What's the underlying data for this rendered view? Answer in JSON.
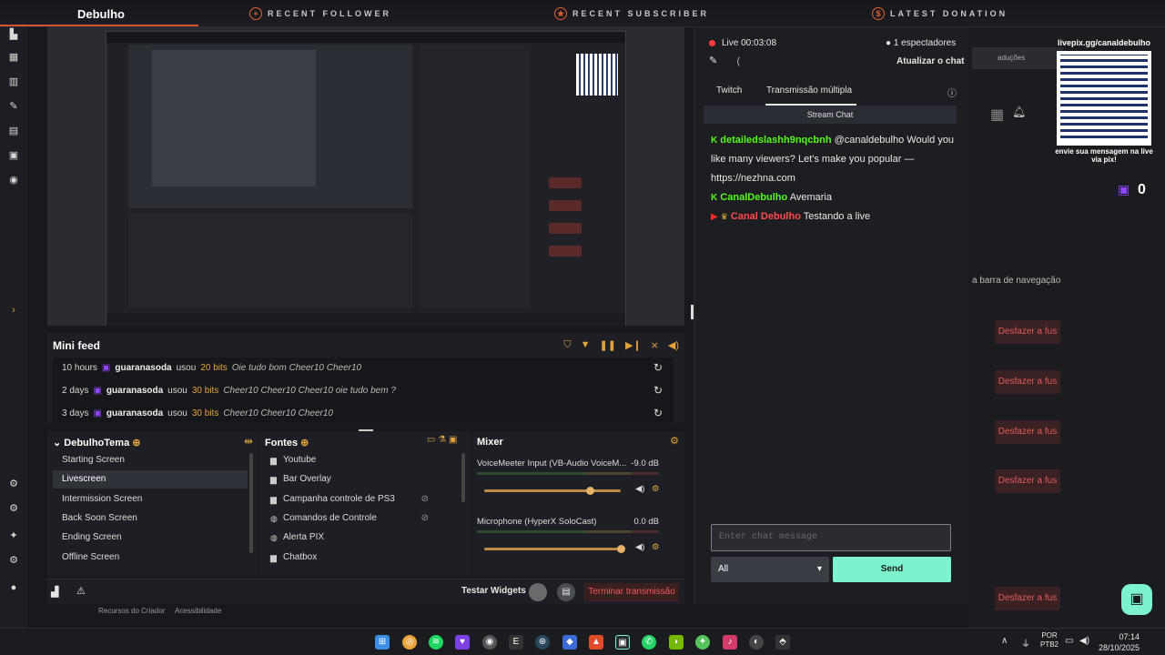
{
  "overlay": {
    "title": "Debulho",
    "segments": [
      "RECENT FOLLOWER",
      "RECENT SUBSCRIBER",
      "LATEST DONATION"
    ],
    "accent": "#e2632e"
  },
  "minifeed": {
    "title": "Mini feed",
    "rows": [
      {
        "time": "10 hours",
        "user": "guaranasoda",
        "action": "usou",
        "bits": "20 bits",
        "msg": "Oie tudo bom Cheer10 Cheer10"
      },
      {
        "time": "2 days",
        "user": "guaranasoda",
        "action": "usou",
        "bits": "30 bits",
        "msg": "Cheer10 Cheer10 Cheer10 oie tudo bem ?"
      },
      {
        "time": "3 days",
        "user": "guaranasoda",
        "action": "usou",
        "bits": "30 bits",
        "msg": "Cheer10 Cheer10 Cheer10"
      }
    ]
  },
  "scenes": {
    "title": "DebulhoTema",
    "items": [
      "Starting Screen",
      "Livescreen",
      "Intermission Screen",
      "Back Soon Screen",
      "Ending Screen",
      "Offline Screen"
    ],
    "active": 1
  },
  "sources": {
    "title": "Fontes",
    "items": [
      {
        "label": "Youtube",
        "icon": "folder-icon",
        "glyph": "▆"
      },
      {
        "label": "Bar Overlay",
        "icon": "folder-icon",
        "glyph": "▆"
      },
      {
        "label": "Campanha controle de PS3",
        "icon": "gamepad-icon",
        "glyph": "▆"
      },
      {
        "label": "Comandos de Controle",
        "icon": "globe-icon",
        "glyph": "◍"
      },
      {
        "label": "Alerta PIX",
        "icon": "globe-icon",
        "glyph": "◍"
      },
      {
        "label": "Chatbox",
        "icon": "folder-icon",
        "glyph": "▆"
      }
    ]
  },
  "mixer": {
    "title": "Mixer",
    "channels": [
      {
        "name": "VoiceMeeter Input (VB-Audio VoiceM...",
        "db": "-9.0 dB",
        "level": 0.78
      },
      {
        "name": "Microphone (HyperX SoloCast)",
        "db": "0.0 dB",
        "level": 1.0
      }
    ]
  },
  "bottombar": {
    "test_widgets": "Testar Widgets",
    "end_stream": "Terminar transmissão"
  },
  "chat": {
    "live": "Live 00:03:08",
    "viewers": "1 espectadores",
    "refresh": "Atualizar o chat",
    "tabs": [
      "Twitch",
      "Transmissão múltipla"
    ],
    "stream_chat": "Stream Chat",
    "messages": [
      {
        "platform": "kick",
        "user": "detailedslashh9nqcbnh",
        "user_color": "#53fc18",
        "text": "@canaldebulho Would you like many viewers? Let's make you popular — https://nezhna.com"
      },
      {
        "platform": "kick",
        "user": "CanalDebulho",
        "user_color": "#53fc18",
        "text": "Avemaria"
      },
      {
        "platform": "youtube",
        "user": "Canal Debulho",
        "user_color": "#ff4b4b",
        "text": "Testando a live"
      }
    ],
    "input_placeholder": "Enter chat message",
    "select_value": "All",
    "send": "Send"
  },
  "right_panel": {
    "qr_title": "livepix.gg/canaldebulho",
    "qr_caption": "envie sua mensagem na live via pix!",
    "count": "0",
    "nav_text": "a barra de navegação",
    "top_text": "aduções",
    "undo_label": "Desfazer a fus"
  },
  "footer": {
    "left1": "Recursos do Criador",
    "left2": "Acessibilidade"
  },
  "taskbar": {
    "lang": "POR",
    "layout": "PTB2",
    "time": "07:14",
    "date": "28/10/2025"
  }
}
